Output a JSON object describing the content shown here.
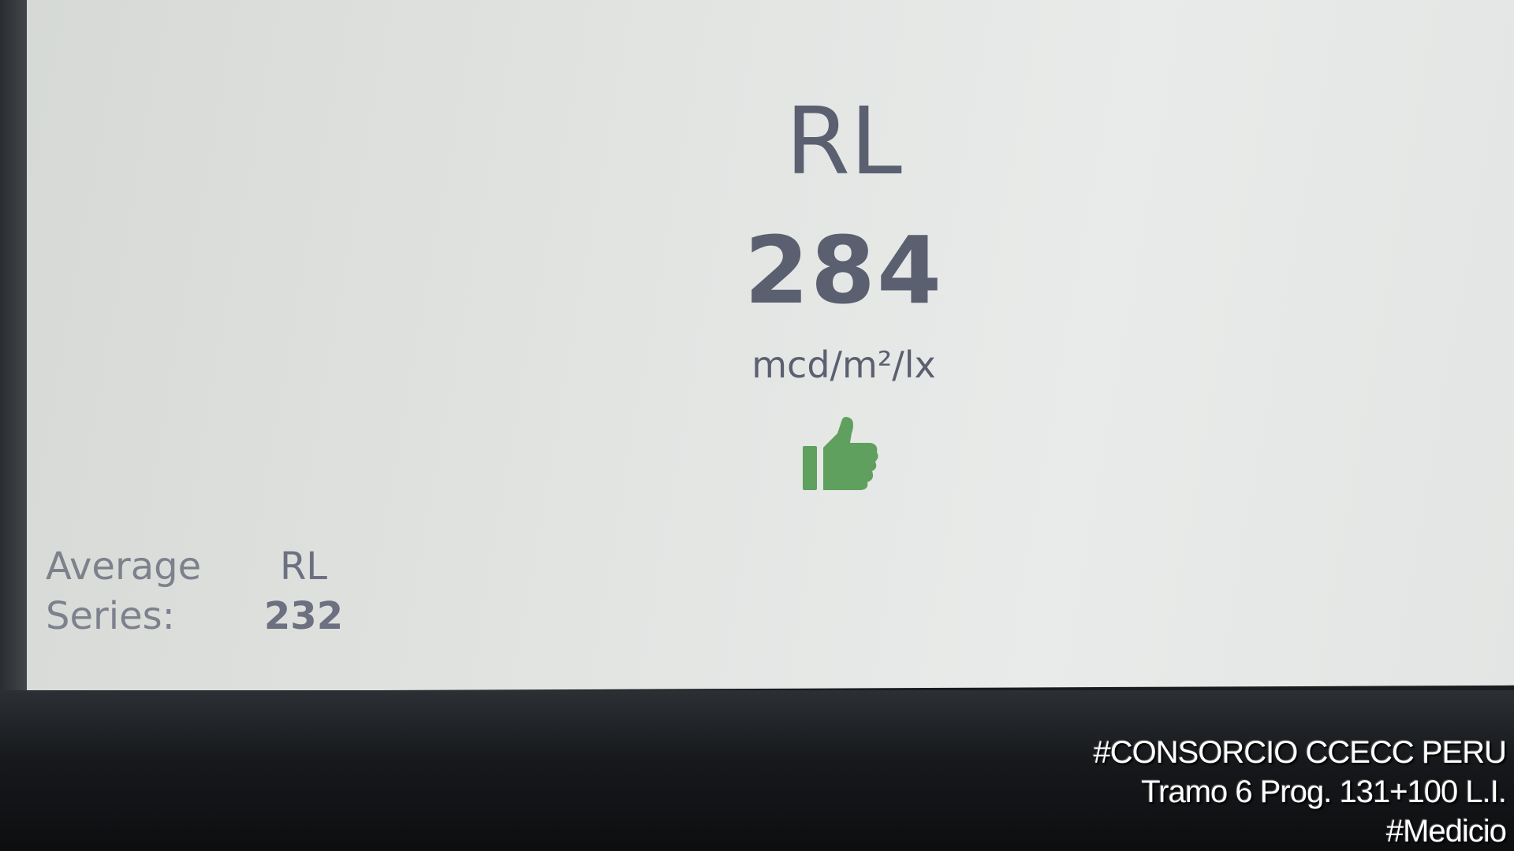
{
  "measurement": {
    "parameter": "RL",
    "value": "284",
    "unit": "mcd/m²/lx",
    "status_icon": "thumbs-up-icon",
    "status_color": "#5fa05f"
  },
  "average": {
    "label_line1": "Average",
    "label_line2": "Series:",
    "parameter": "RL",
    "value": "232"
  },
  "caption": {
    "line1": "#CONSORCIO CCECC PERU",
    "line2": "Tramo 6 Prog. 131+100 L.I.",
    "line3": "#Medicio"
  }
}
